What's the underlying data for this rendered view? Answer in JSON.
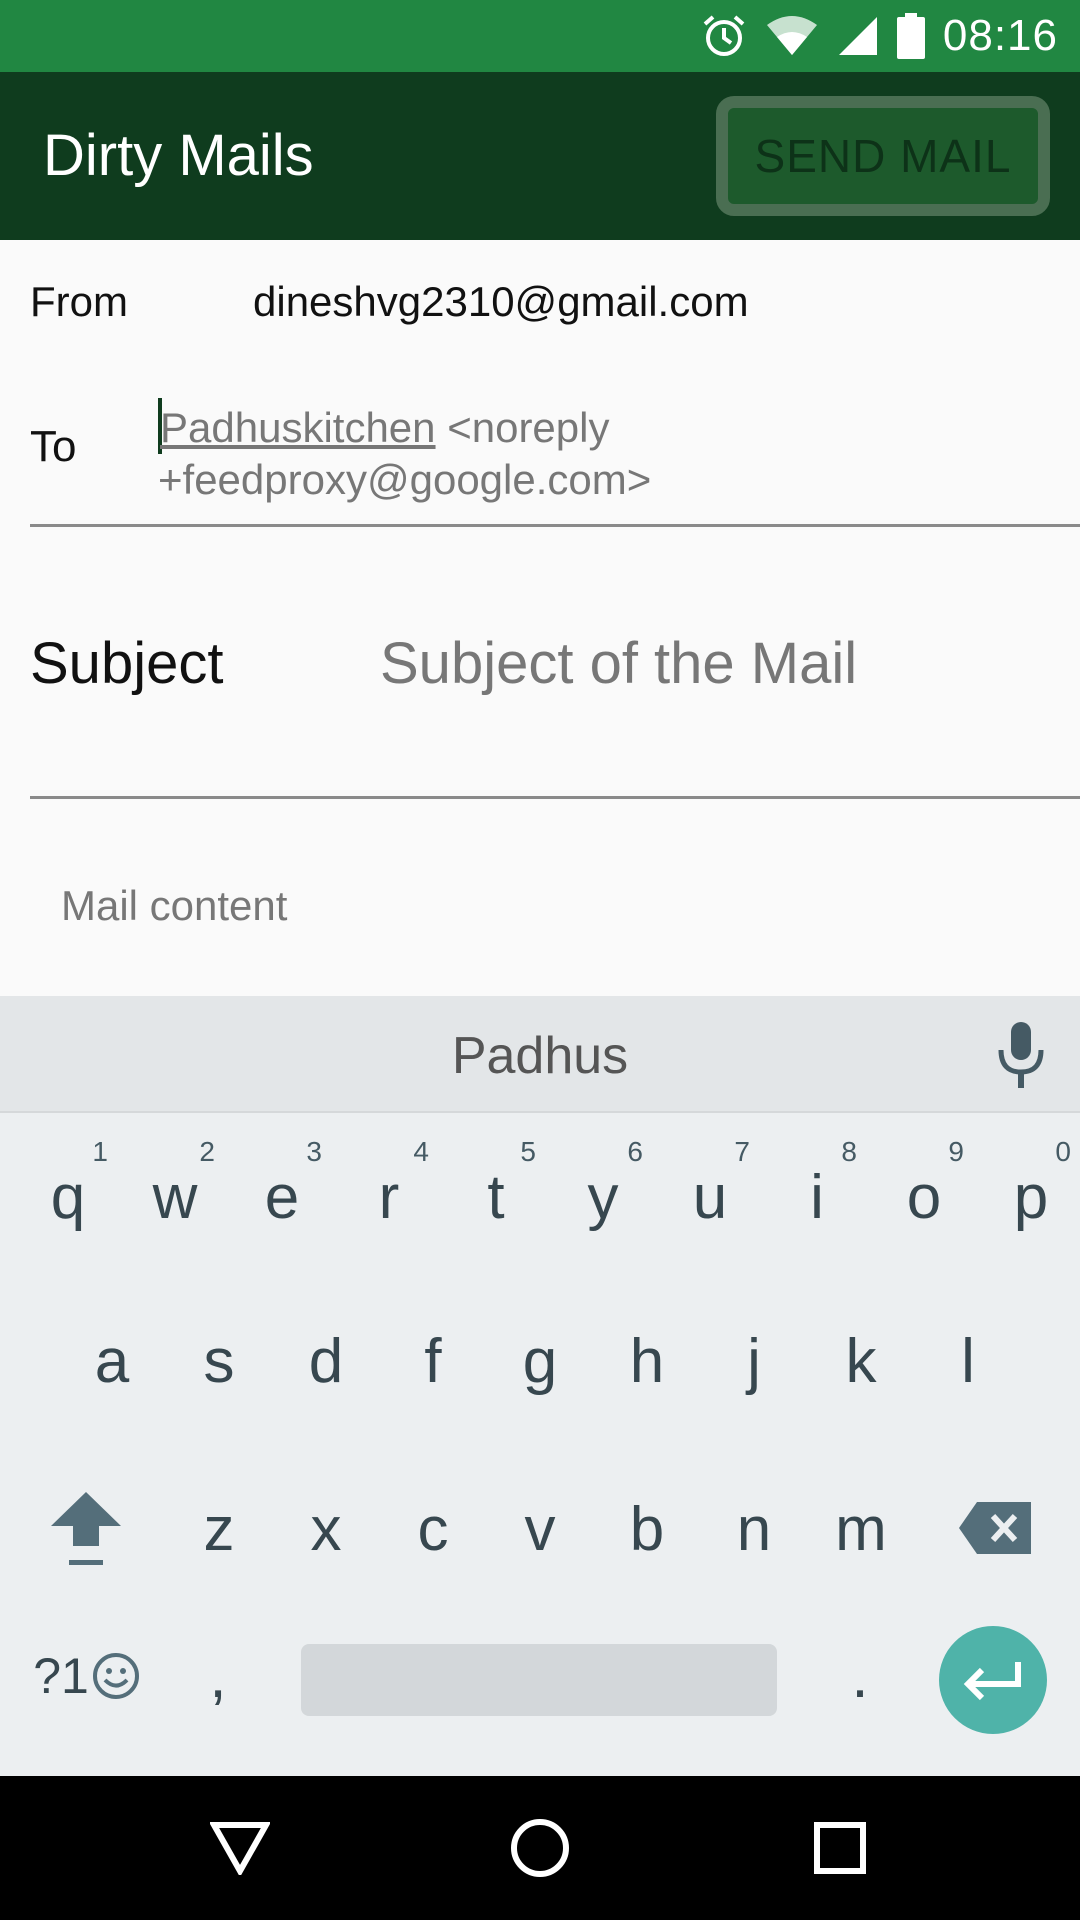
{
  "status_bar": {
    "time": "08:16",
    "icons": [
      "alarm-icon",
      "wifi-icon",
      "signal-icon",
      "battery-icon"
    ]
  },
  "app_bar": {
    "title": "Dirty Mails",
    "send_label": "SEND MAIL"
  },
  "form": {
    "from_label": "From",
    "from_value": "dineshvg2310@gmail.com",
    "to_label": "To",
    "to_suggestion_word": "Padhuskitchen",
    "to_suggestion_rest": " <noreply +feedproxy@google.com>",
    "subject_label": "Subject",
    "subject_placeholder": "Subject of the Mail",
    "content_placeholder": "Mail content"
  },
  "keyboard": {
    "suggestion": "Padhus",
    "row1": [
      {
        "key": "q",
        "hint": "1"
      },
      {
        "key": "w",
        "hint": "2"
      },
      {
        "key": "e",
        "hint": "3"
      },
      {
        "key": "r",
        "hint": "4"
      },
      {
        "key": "t",
        "hint": "5"
      },
      {
        "key": "y",
        "hint": "6"
      },
      {
        "key": "u",
        "hint": "7"
      },
      {
        "key": "i",
        "hint": "8"
      },
      {
        "key": "o",
        "hint": "9"
      },
      {
        "key": "p",
        "hint": "0"
      }
    ],
    "row2": [
      "a",
      "s",
      "d",
      "f",
      "g",
      "h",
      "j",
      "k",
      "l"
    ],
    "row3": [
      "z",
      "x",
      "c",
      "v",
      "b",
      "n",
      "m"
    ],
    "symbols_label": "?1",
    "comma": ",",
    "period": "."
  },
  "colors": {
    "status_bar": "#218742",
    "app_bar": "#0f3c1e",
    "enter_key": "#4fb3a9"
  }
}
